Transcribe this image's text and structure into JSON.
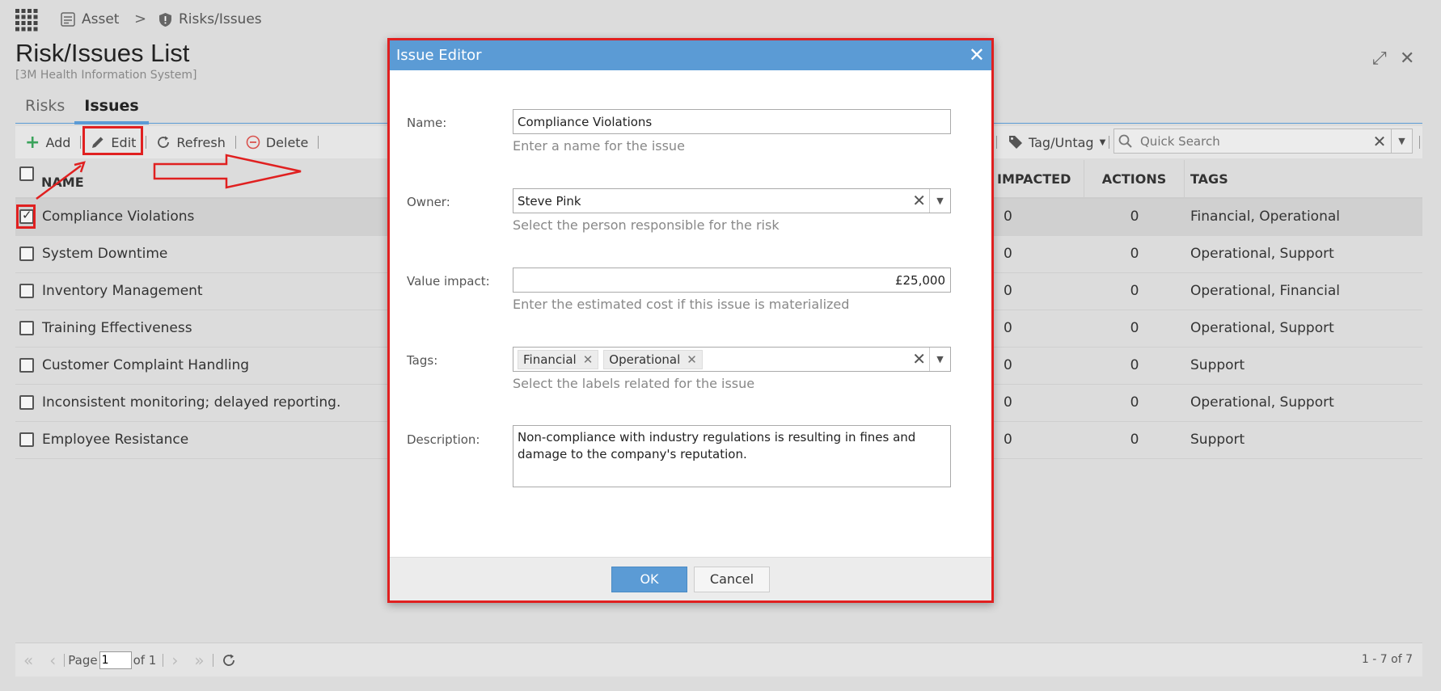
{
  "breadcrumb": {
    "asset": "Asset",
    "separator": ">",
    "current": "Risks/Issues"
  },
  "page": {
    "title": "Risk/Issues List",
    "subtitle": "[3M Health Information System]"
  },
  "tabs": [
    {
      "label": "Risks"
    },
    {
      "label": "Issues",
      "active": true
    }
  ],
  "toolbar": {
    "add_label": "Add",
    "edit_label": "Edit",
    "refresh_label": "Refresh",
    "delete_label": "Delete",
    "tag_untag_label": "Tag/Untag",
    "search_placeholder": "Quick Search"
  },
  "grid": {
    "columns": {
      "name": "NAME",
      "impacted": "IMPACTED",
      "actions": "ACTIONS",
      "tags": "TAGS"
    },
    "rows": [
      {
        "name": "Compliance Violations",
        "impacted": "0",
        "actions": "0",
        "tags": "Financial, Operational",
        "checked": true
      },
      {
        "name": "System Downtime",
        "impacted": "0",
        "actions": "0",
        "tags": "Operational, Support"
      },
      {
        "name": "Inventory Management",
        "impacted": "0",
        "actions": "0",
        "tags": "Operational, Financial"
      },
      {
        "name": "Training Effectiveness",
        "impacted": "0",
        "actions": "0",
        "tags": "Operational, Support"
      },
      {
        "name": "Customer Complaint Handling",
        "impacted": "0",
        "actions": "0",
        "tags": "Support"
      },
      {
        "name": "Inconsistent monitoring; delayed reporting.",
        "impacted": "0",
        "actions": "0",
        "tags": "Operational, Support"
      },
      {
        "name": "Employee Resistance",
        "impacted": "0",
        "actions": "0",
        "tags": "Support"
      }
    ]
  },
  "pager": {
    "page_label": "Page",
    "page_value": "1",
    "of_label": "of 1",
    "info": "1 - 7 of 7"
  },
  "modal": {
    "title": "Issue Editor",
    "name_label": "Name:",
    "name_value": "Compliance Violations",
    "name_hint": "Enter a name for the issue",
    "owner_label": "Owner:",
    "owner_value": "Steve Pink",
    "owner_hint": "Select the person responsible for the risk",
    "value_label": "Value impact:",
    "value_value": "£25,000",
    "value_hint": "Enter the estimated cost if this issue is materialized",
    "tags_label": "Tags:",
    "tags": [
      "Financial",
      "Operational"
    ],
    "tags_hint": "Select the labels related for the issue",
    "description_label": "Description:",
    "description_value": "Non-compliance with industry regulations is resulting in fines and damage to the company's reputation.",
    "ok_label": "OK",
    "cancel_label": "Cancel"
  },
  "colors": {
    "accent": "#5b9bd5",
    "annotation": "#e02020",
    "add_green": "#3aa35b",
    "delete_red": "#d9534f"
  }
}
